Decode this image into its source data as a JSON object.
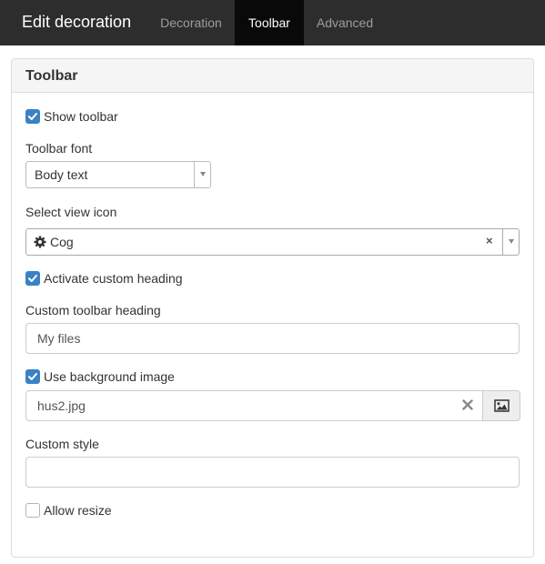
{
  "topbar": {
    "title": "Edit decoration",
    "tabs": [
      {
        "label": "Decoration",
        "active": false
      },
      {
        "label": "Toolbar",
        "active": true
      },
      {
        "label": "Advanced",
        "active": false
      }
    ]
  },
  "panel": {
    "title": "Toolbar",
    "show_toolbar": {
      "label": "Show toolbar",
      "checked": true
    },
    "toolbar_font": {
      "label": "Toolbar font",
      "value": "Body text"
    },
    "view_icon": {
      "label": "Select view icon",
      "value": "Cog",
      "icon": "cog-icon"
    },
    "custom_heading_toggle": {
      "label": "Activate custom heading",
      "checked": true
    },
    "custom_heading": {
      "label": "Custom toolbar heading",
      "value": "My files"
    },
    "background_image_toggle": {
      "label": "Use background image",
      "checked": true
    },
    "background_image": {
      "value": "hus2.jpg"
    },
    "custom_style": {
      "label": "Custom style",
      "value": ""
    },
    "allow_resize": {
      "label": "Allow resize",
      "checked": false
    }
  },
  "colors": {
    "topbar_bg": "#2d2d2d",
    "active_tab_bg": "#090909",
    "checkbox_checked": "#3a82c4"
  }
}
